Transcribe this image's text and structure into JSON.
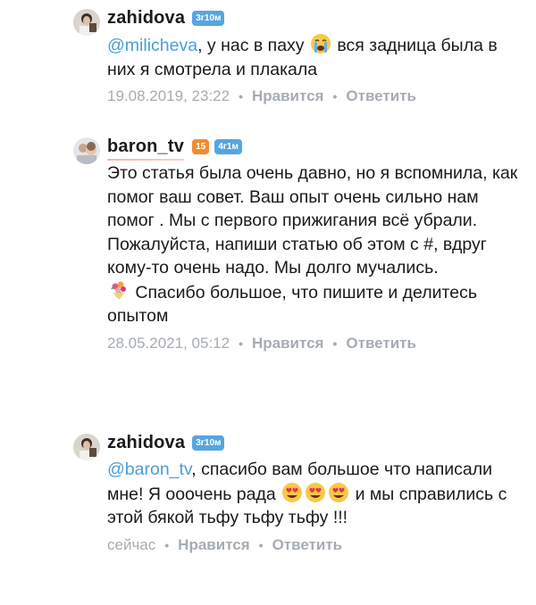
{
  "comments": [
    {
      "username": "zahidova",
      "badges": [
        {
          "text": "3г10м",
          "color": "#55a6e0"
        }
      ],
      "mention": "@milicheva",
      "text_part1": ", у нас в паху ",
      "text_part2": " вся задница была в них я смотрела и плакала",
      "emoji1": "crying-face",
      "timestamp": "19.08.2019, 23:22",
      "like": "Нравится",
      "reply": "Ответить"
    },
    {
      "username": "baron_tv",
      "badges": [
        {
          "text": "15",
          "color": "#f28c2f"
        },
        {
          "text": "4г1м",
          "color": "#55a6e0"
        }
      ],
      "text_main": "Это статья была очень давно, но я вспомнила, как помог ваш совет.  Ваш опыт очень сильно нам помог . Мы с первого прижигания всё убрали. Пожалуйста,  напиши статью об этом с #, вдруг кому-то очень надо. Мы долго мучались.",
      "text_tail": "  Спасибо  большое,  что пишите и делитесь опытом",
      "emoji1": "bouquet",
      "timestamp": "28.05.2021, 05:12",
      "like": "Нравится",
      "reply": "Ответить"
    },
    {
      "username": "zahidova",
      "badges": [
        {
          "text": "3г10м",
          "color": "#55a6e0"
        }
      ],
      "mention": "@baron_tv",
      "text_part1": ", спасибо вам большое что написали мне! Я ооочень рада ",
      "text_part2": " и мы справились с этой бякой тьфу тьфу тьфу !!!",
      "emoji1": "heart-eyes",
      "timestamp": "сейчас",
      "like": "Нравится",
      "reply": "Ответить"
    }
  ]
}
